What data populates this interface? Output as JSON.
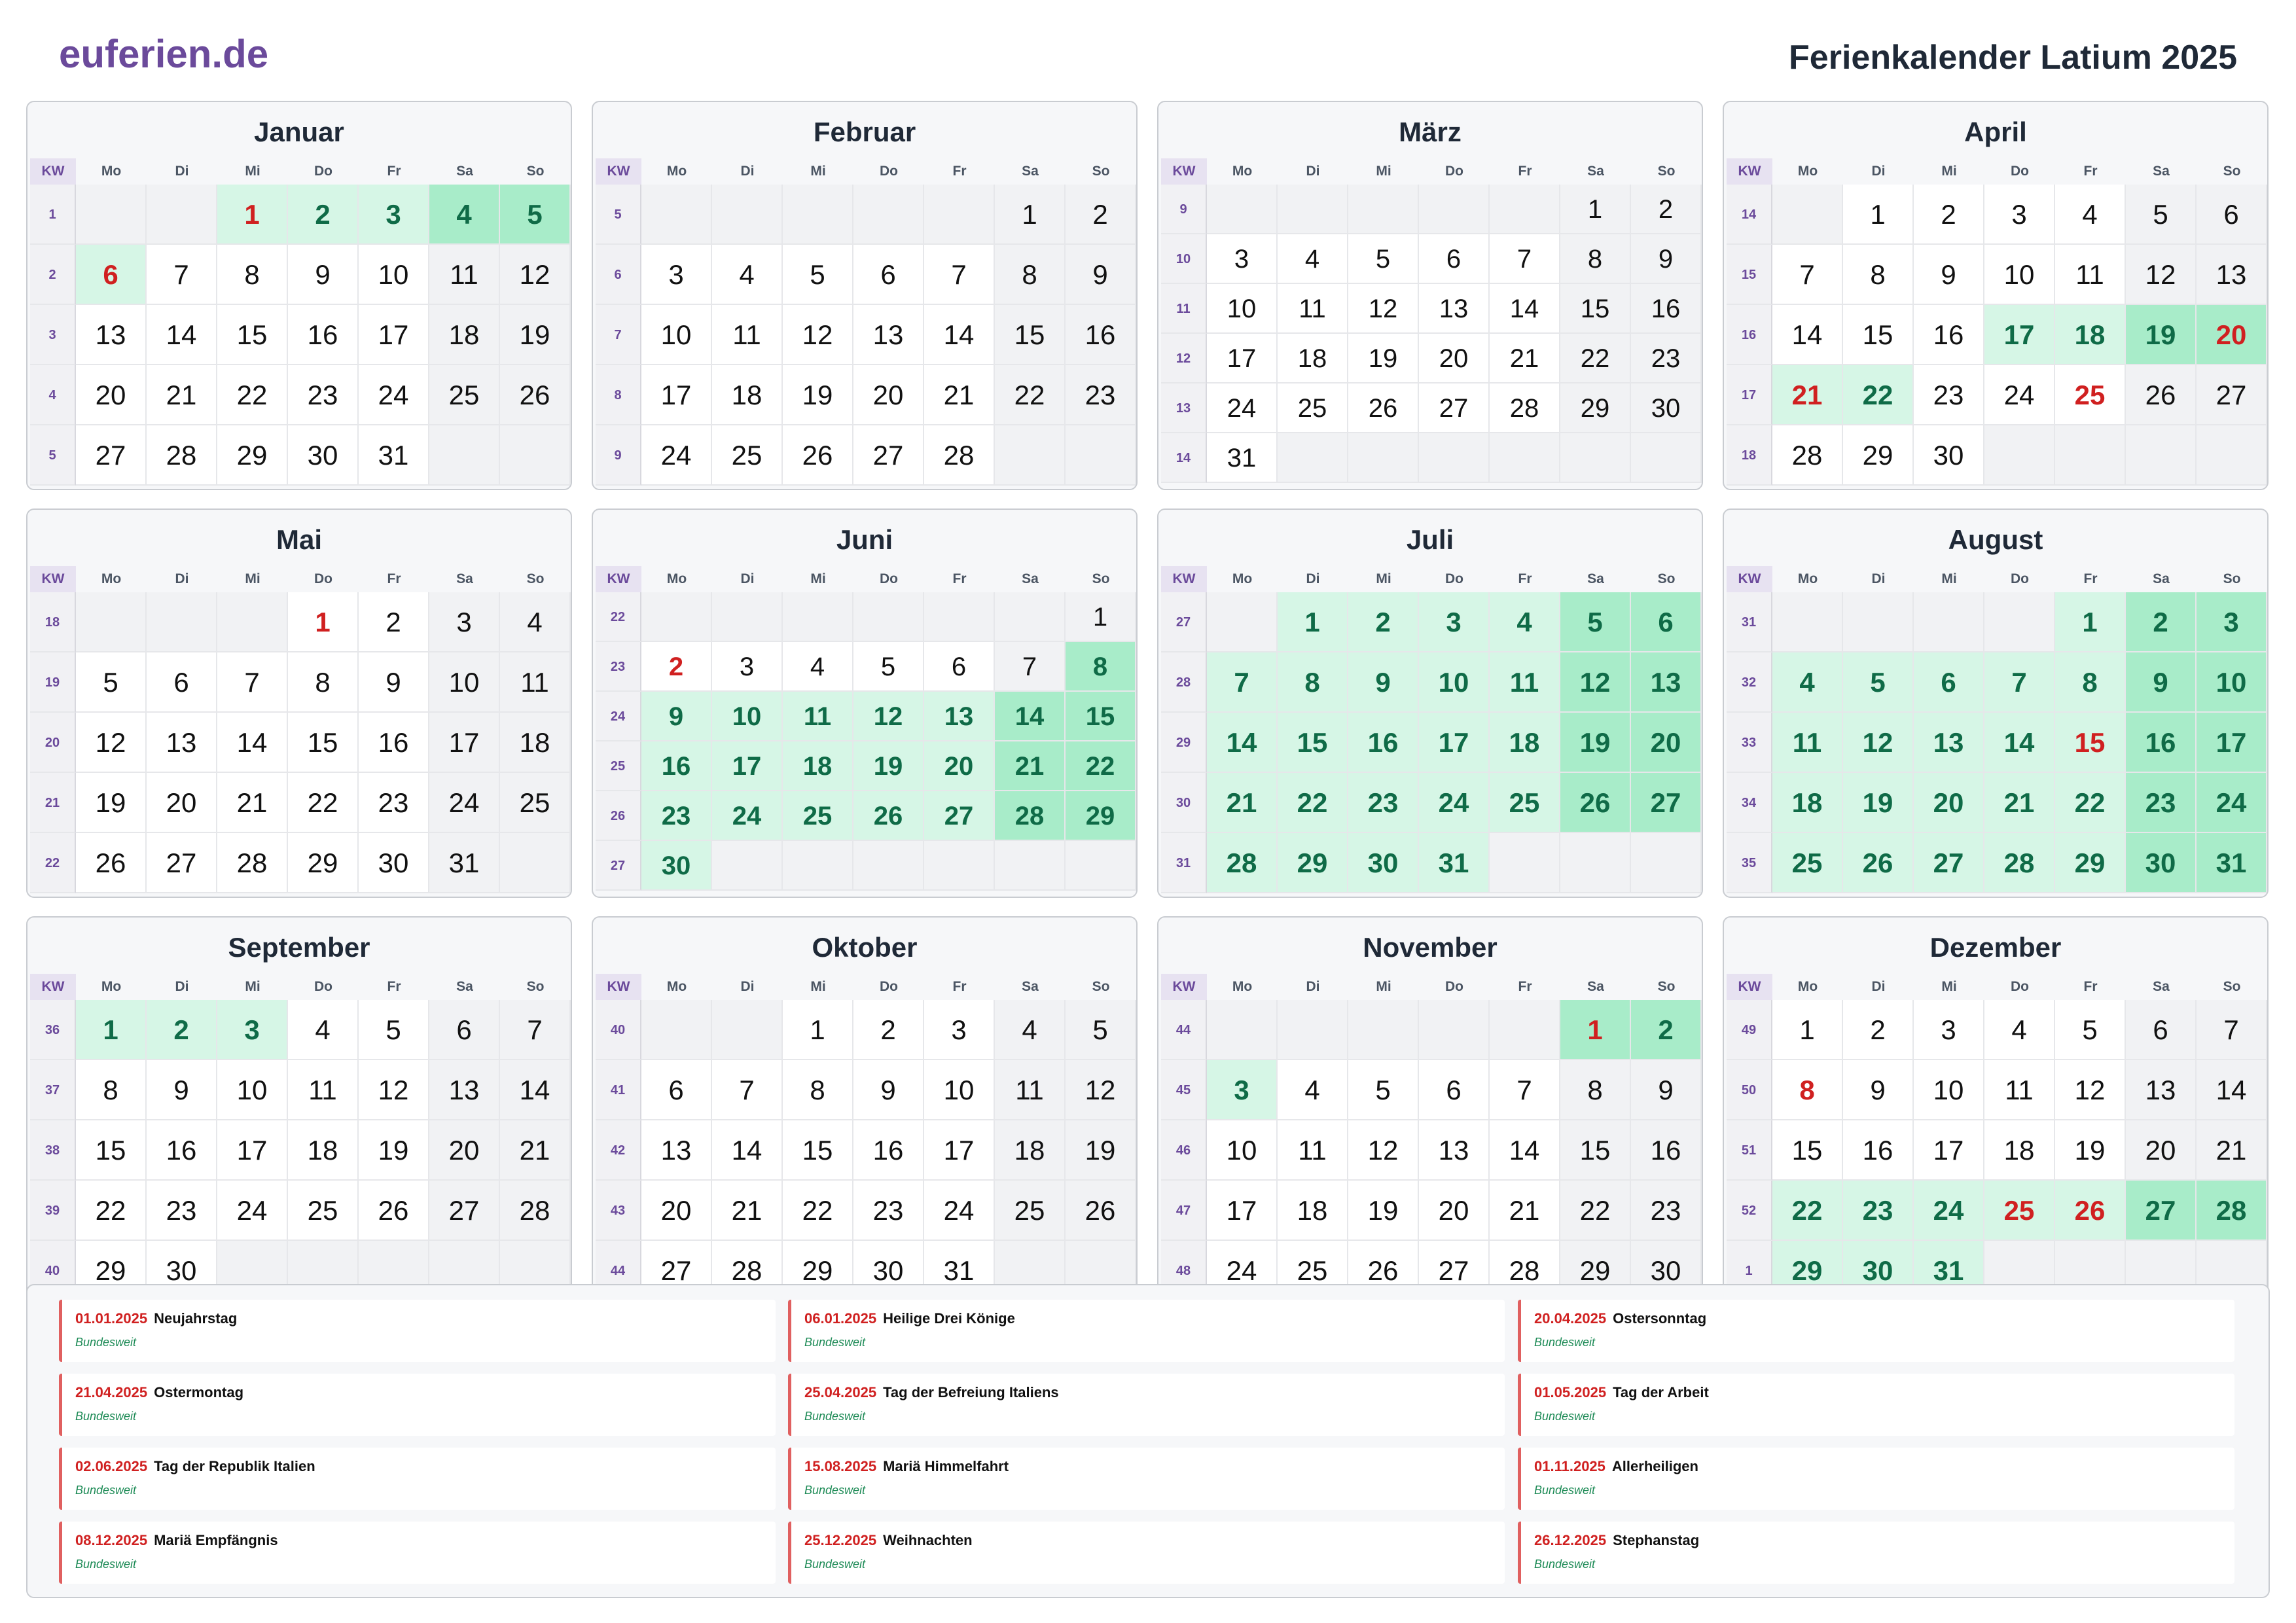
{
  "header": {
    "logo": "euferien.de",
    "title": "Ferienkalender Latium 2025"
  },
  "weekday_header": {
    "kw": "KW",
    "days": [
      "Mo",
      "Di",
      "Mi",
      "Do",
      "Fr",
      "Sa",
      "So"
    ]
  },
  "months": [
    {
      "name": "Januar",
      "weeks": [
        1,
        2,
        3,
        4,
        5
      ],
      "first_weekday": 2,
      "days": 31,
      "school_holidays": [
        1,
        2,
        3,
        4,
        5,
        6
      ],
      "public_holidays": [
        1,
        6
      ]
    },
    {
      "name": "Februar",
      "weeks": [
        5,
        6,
        7,
        8,
        9
      ],
      "first_weekday": 5,
      "days": 28,
      "school_holidays": [],
      "public_holidays": []
    },
    {
      "name": "März",
      "weeks": [
        9,
        10,
        11,
        12,
        13,
        14
      ],
      "first_weekday": 5,
      "days": 31,
      "school_holidays": [],
      "public_holidays": []
    },
    {
      "name": "April",
      "weeks": [
        14,
        15,
        16,
        17,
        18
      ],
      "first_weekday": 1,
      "days": 30,
      "school_holidays": [
        17,
        18,
        19,
        20,
        21,
        22
      ],
      "public_holidays": [
        20,
        21,
        25
      ]
    },
    {
      "name": "Mai",
      "weeks": [
        18,
        19,
        20,
        21,
        22
      ],
      "first_weekday": 3,
      "days": 31,
      "school_holidays": [],
      "public_holidays": [
        1
      ]
    },
    {
      "name": "Juni",
      "weeks": [
        22,
        23,
        24,
        25,
        26,
        27
      ],
      "first_weekday": 6,
      "days": 30,
      "school_holidays": [
        8,
        9,
        10,
        11,
        12,
        13,
        14,
        15,
        16,
        17,
        18,
        19,
        20,
        21,
        22,
        23,
        24,
        25,
        26,
        27,
        28,
        29,
        30
      ],
      "public_holidays": [
        2
      ]
    },
    {
      "name": "Juli",
      "weeks": [
        27,
        28,
        29,
        30,
        31
      ],
      "first_weekday": 1,
      "days": 31,
      "school_holidays": [
        1,
        2,
        3,
        4,
        5,
        6,
        7,
        8,
        9,
        10,
        11,
        12,
        13,
        14,
        15,
        16,
        17,
        18,
        19,
        20,
        21,
        22,
        23,
        24,
        25,
        26,
        27,
        28,
        29,
        30,
        31
      ],
      "public_holidays": []
    },
    {
      "name": "August",
      "weeks": [
        31,
        32,
        33,
        34,
        35
      ],
      "first_weekday": 4,
      "days": 31,
      "school_holidays": [
        1,
        2,
        3,
        4,
        5,
        6,
        7,
        8,
        9,
        10,
        11,
        12,
        13,
        14,
        15,
        16,
        17,
        18,
        19,
        20,
        21,
        22,
        23,
        24,
        25,
        26,
        27,
        28,
        29,
        30,
        31
      ],
      "public_holidays": [
        15
      ]
    },
    {
      "name": "September",
      "weeks": [
        36,
        37,
        38,
        39,
        40
      ],
      "first_weekday": 0,
      "days": 30,
      "school_holidays": [
        1,
        2,
        3
      ],
      "public_holidays": []
    },
    {
      "name": "Oktober",
      "weeks": [
        40,
        41,
        42,
        43,
        44
      ],
      "first_weekday": 2,
      "days": 31,
      "school_holidays": [],
      "public_holidays": []
    },
    {
      "name": "November",
      "weeks": [
        44,
        45,
        46,
        47,
        48
      ],
      "first_weekday": 5,
      "days": 30,
      "school_holidays": [
        1,
        2,
        3
      ],
      "public_holidays": [
        1
      ]
    },
    {
      "name": "Dezember",
      "weeks": [
        49,
        50,
        51,
        52,
        1
      ],
      "first_weekday": 0,
      "days": 31,
      "school_holidays": [
        22,
        23,
        24,
        25,
        26,
        27,
        28,
        29,
        30,
        31
      ],
      "public_holidays": [
        8,
        25,
        26
      ]
    }
  ],
  "holidays": [
    {
      "date": "01.01.2025",
      "name": "Neujahrstag",
      "region": "Bundesweit"
    },
    {
      "date": "06.01.2025",
      "name": "Heilige Drei Könige",
      "region": "Bundesweit"
    },
    {
      "date": "20.04.2025",
      "name": "Ostersonntag",
      "region": "Bundesweit"
    },
    {
      "date": "21.04.2025",
      "name": "Ostermontag",
      "region": "Bundesweit"
    },
    {
      "date": "25.04.2025",
      "name": "Tag der Befreiung Italiens",
      "region": "Bundesweit"
    },
    {
      "date": "01.05.2025",
      "name": "Tag der Arbeit",
      "region": "Bundesweit"
    },
    {
      "date": "02.06.2025",
      "name": "Tag der Republik Italien",
      "region": "Bundesweit"
    },
    {
      "date": "15.08.2025",
      "name": "Mariä Himmelfahrt",
      "region": "Bundesweit"
    },
    {
      "date": "01.11.2025",
      "name": "Allerheiligen",
      "region": "Bundesweit"
    },
    {
      "date": "08.12.2025",
      "name": "Mariä Empfängnis",
      "region": "Bundesweit"
    },
    {
      "date": "25.12.2025",
      "name": "Weihnachten",
      "region": "Bundesweit"
    },
    {
      "date": "26.12.2025",
      "name": "Stephanstag",
      "region": "Bundesweit"
    }
  ],
  "colors": {
    "brand": "#6b4a9b",
    "school_holiday": "#d6f6e6",
    "school_holiday_weekend": "#a8ecc9",
    "public_holiday_text": "#d02020",
    "weekend": "#f1f2f4"
  }
}
